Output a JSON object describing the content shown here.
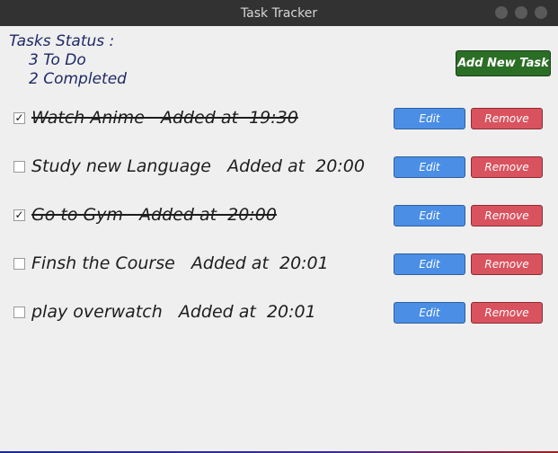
{
  "window": {
    "title": "Task Tracker"
  },
  "status": {
    "header": "Tasks Status :",
    "todo": "3 To Do",
    "completed": "2  Completed"
  },
  "toolbar": {
    "add_label": "Add New Task"
  },
  "tasks": [
    {
      "text": "Watch Anime   Added at  19:30",
      "checked": true,
      "check_mark": "✓",
      "edit_label": "Edit",
      "remove_label": "Remove"
    },
    {
      "text": "Study new Language   Added at  20:00",
      "checked": false,
      "check_mark": "",
      "edit_label": "Edit",
      "remove_label": "Remove"
    },
    {
      "text": "Go to Gym   Added at  20:00",
      "checked": true,
      "check_mark": "✓",
      "edit_label": "Edit",
      "remove_label": "Remove"
    },
    {
      "text": "Finsh the Course   Added at  20:01",
      "checked": false,
      "check_mark": "",
      "edit_label": "Edit",
      "remove_label": "Remove"
    },
    {
      "text": "play overwatch   Added at  20:01",
      "checked": false,
      "check_mark": "",
      "edit_label": "Edit",
      "remove_label": "Remove"
    }
  ],
  "colors": {
    "edit": "#4a8ee6",
    "remove": "#d9535f",
    "add": "#2b6e25",
    "status_text": "#1e2a66"
  }
}
